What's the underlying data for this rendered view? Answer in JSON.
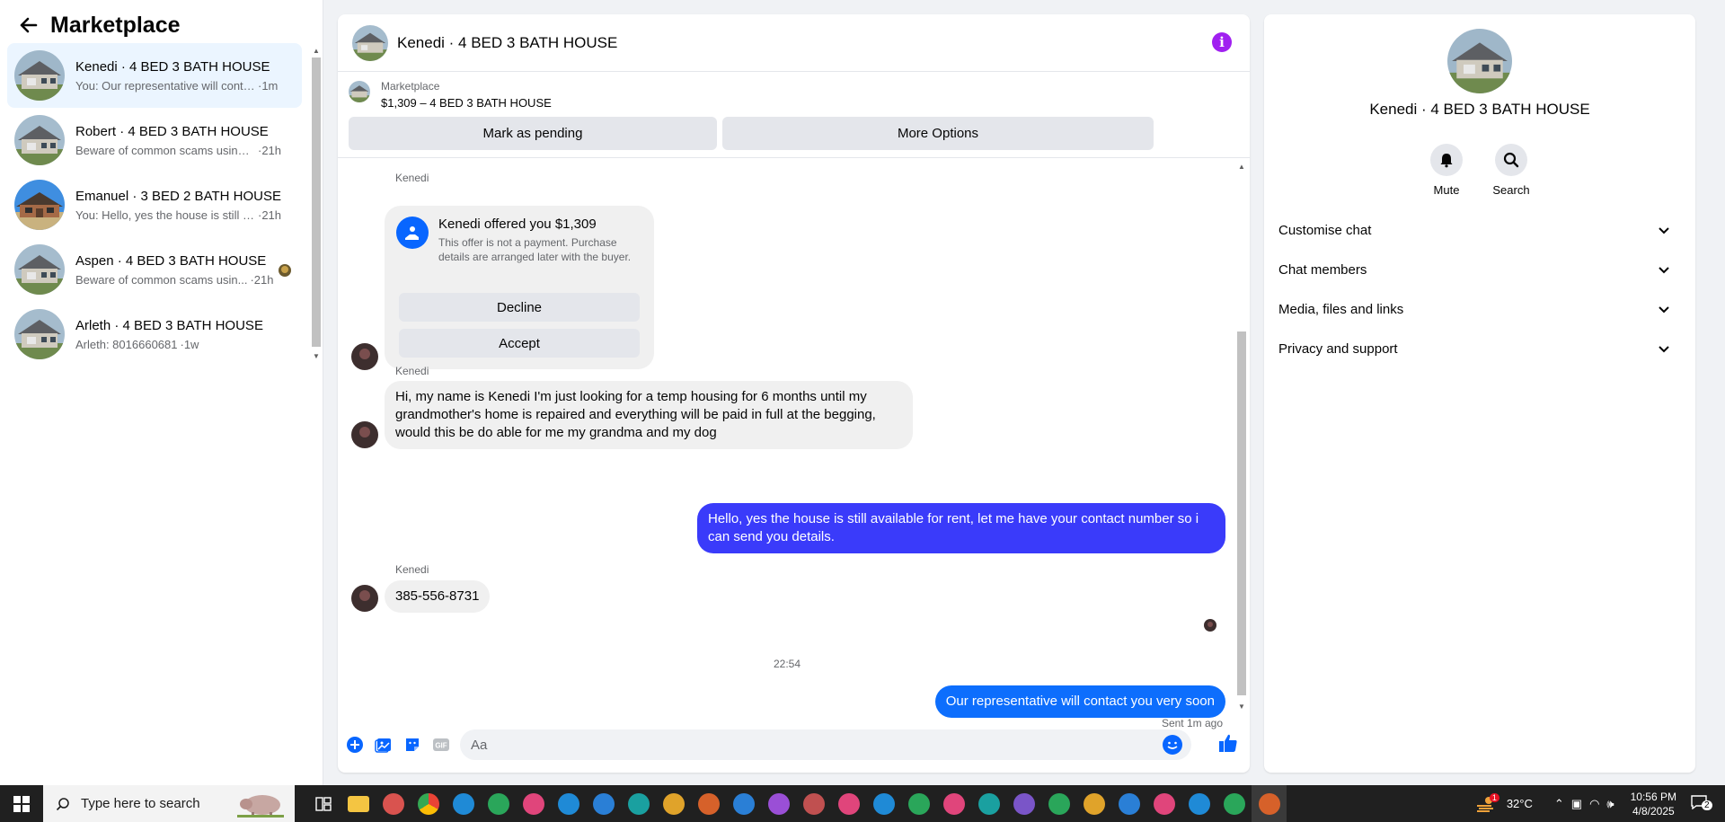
{
  "sidebar": {
    "title": "Marketplace",
    "conversations": [
      {
        "name": "Kenedi · 4 BED 3 BATH HOUSE",
        "snippet": "You: Our representative will conta...",
        "time": "·1m",
        "active": true,
        "avatar": "house"
      },
      {
        "name": "Robert · 4 BED 3 BATH HOUSE",
        "snippet": "Beware of common scams using ...",
        "time": "·21h",
        "active": false,
        "avatar": "house"
      },
      {
        "name": "Emanuel · 3 BED 2 BATH HOUSE",
        "snippet": "You: Hello, yes the house is still av...",
        "time": "·21h",
        "active": false,
        "avatar": "brick-house"
      },
      {
        "name": "Aspen · 4 BED 3 BATH HOUSE",
        "snippet": "Beware of common scams usin...",
        "time": "·21h",
        "active": false,
        "avatar": "house",
        "badge": true
      },
      {
        "name": "Arleth · 4 BED 3 BATH HOUSE",
        "snippet": "Arleth: 8016660681",
        "time": "·1w",
        "active": false,
        "avatar": "house"
      }
    ]
  },
  "chat": {
    "title": "Kenedi · 4 BED 3 BATH HOUSE",
    "listing_source": "Marketplace",
    "listing_price": "$1,309 – 4 BED 3 BATH HOUSE",
    "mark_pending_label": "Mark as pending",
    "more_options_label": "More Options",
    "offer": {
      "sender": "Kenedi",
      "title": "Kenedi offered you $1,309",
      "description": "This offer is not a payment. Purchase details are arranged later with the buyer.",
      "decline_label": "Decline",
      "accept_label": "Accept"
    },
    "messages": [
      {
        "sender": "Kenedi",
        "text": "Hi, my name is Kenedi I'm just looking for a temp housing for 6 months until my grandmother's home is repaired and everything will be paid in full at the begging, would this be do able for me my grandma and my dog"
      },
      {
        "sender": "You",
        "text": "Hello, yes the house is still available for rent, let me have your contact number so i can send you details."
      },
      {
        "sender": "Kenedi",
        "text": "385-556-8731"
      },
      {
        "sender": "You",
        "text": "Our representative will contact you very soon"
      }
    ],
    "sender_label": "Kenedi",
    "time_separator": "22:54",
    "sent_status": "Sent 1m ago",
    "composer_placeholder": "Aa"
  },
  "details": {
    "name": "Kenedi · 4 BED 3 BATH HOUSE",
    "mute_label": "Mute",
    "search_label": "Search",
    "sections": [
      "Customise chat",
      "Chat members",
      "Media, files and links",
      "Privacy and support"
    ]
  },
  "taskbar": {
    "search_placeholder": "Type here to search",
    "weather": "32°C",
    "weather_alert": "1",
    "time": "10:56 PM",
    "date": "4/8/2025",
    "notification_count": "2"
  },
  "colors": {
    "accent": "#0866ff",
    "outgoing_bubble_1": "#3a3bfa",
    "outgoing_bubble_2": "#0d6efd",
    "info_icon": "#a020f0",
    "active_conversation": "#ebf5ff"
  }
}
